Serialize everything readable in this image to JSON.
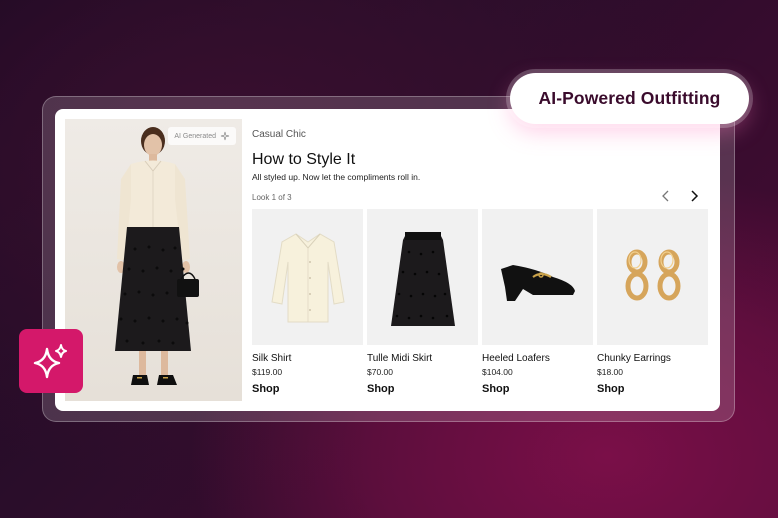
{
  "badge": {
    "label": "AI-Powered Outfitting"
  },
  "hero": {
    "tag": "AI Generated"
  },
  "section": {
    "eyebrow": "Casual Chic",
    "title": "How to Style It",
    "subtitle": "All styled up. Now let the compliments roll in.",
    "look_counter": "Look 1 of 3"
  },
  "nav": {
    "prev_icon": "chevron-left-icon",
    "next_icon": "chevron-right-icon"
  },
  "products": [
    {
      "name": "Silk Shirt",
      "price": "$119.00",
      "cta": "Shop",
      "icon": "shirt-icon"
    },
    {
      "name": "Tulle Midi Skirt",
      "price": "$70.00",
      "cta": "Shop",
      "icon": "skirt-icon"
    },
    {
      "name": "Heeled Loafers",
      "price": "$104.00",
      "cta": "Shop",
      "icon": "loafer-icon"
    },
    {
      "name": "Chunky Earrings",
      "price": "$18.00",
      "cta": "Shop",
      "icon": "earrings-icon"
    }
  ],
  "colors": {
    "accent": "#d4186a",
    "badge_text": "#3a0b2c",
    "background_dark": "#1b0a22"
  }
}
